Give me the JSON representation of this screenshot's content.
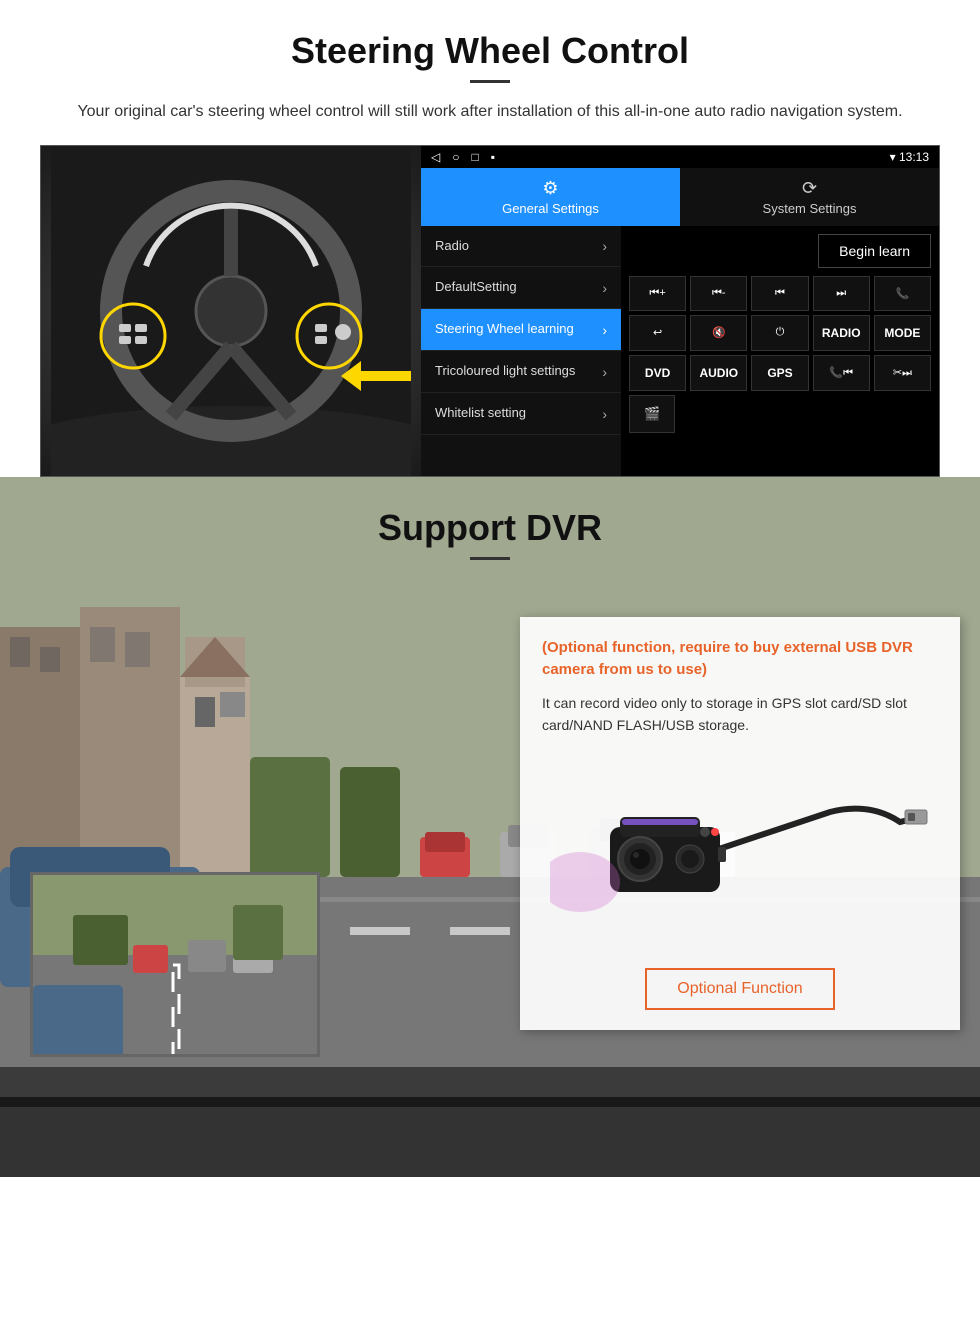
{
  "section1": {
    "title": "Steering Wheel Control",
    "subtitle": "Your original car's steering wheel control will still work after installation of this all-in-one auto radio navigation system.",
    "android_ui": {
      "status_bar": {
        "nav_back": "◁",
        "nav_home": "○",
        "nav_square": "□",
        "nav_dot": "▪",
        "time": "13:13",
        "icons": "▾"
      },
      "tab_general": {
        "icon": "⚙",
        "label": "General Settings"
      },
      "tab_system": {
        "icon": "🔄",
        "label": "System Settings"
      },
      "menu_items": [
        {
          "label": "Radio",
          "active": false
        },
        {
          "label": "DefaultSetting",
          "active": false
        },
        {
          "label": "Steering Wheel learning",
          "active": true
        },
        {
          "label": "Tricoloured light settings",
          "active": false
        },
        {
          "label": "Whitelist setting",
          "active": false
        }
      ],
      "begin_learn": "Begin learn",
      "control_buttons_row1": [
        {
          "label": "▐▌+",
          "type": "icon"
        },
        {
          "label": "▐▌-",
          "type": "icon"
        },
        {
          "label": "|◀◀",
          "type": "icon"
        },
        {
          "label": "▶▶|",
          "type": "icon"
        },
        {
          "label": "📞",
          "type": "icon"
        }
      ],
      "control_buttons_row2": [
        {
          "label": "↩",
          "type": "icon"
        },
        {
          "label": "🔇x",
          "type": "icon"
        },
        {
          "label": "⏻",
          "type": "icon"
        },
        {
          "label": "RADIO",
          "type": "text"
        },
        {
          "label": "MODE",
          "type": "text"
        }
      ],
      "control_buttons_row3": [
        {
          "label": "DVD",
          "type": "text"
        },
        {
          "label": "AUDIO",
          "type": "text"
        },
        {
          "label": "GPS",
          "type": "text"
        },
        {
          "label": "📞|◀◀",
          "type": "icon"
        },
        {
          "label": "✂ ▶▶|",
          "type": "icon"
        }
      ],
      "control_buttons_row4": [
        {
          "label": "📹",
          "type": "icon"
        }
      ]
    }
  },
  "section2": {
    "title": "Support DVR",
    "optional_highlight": "(Optional function, require to buy external USB DVR camera from us to use)",
    "description": "It can record video only to storage in GPS slot card/SD slot card/NAND FLASH/USB storage.",
    "optional_function_btn": "Optional Function"
  }
}
